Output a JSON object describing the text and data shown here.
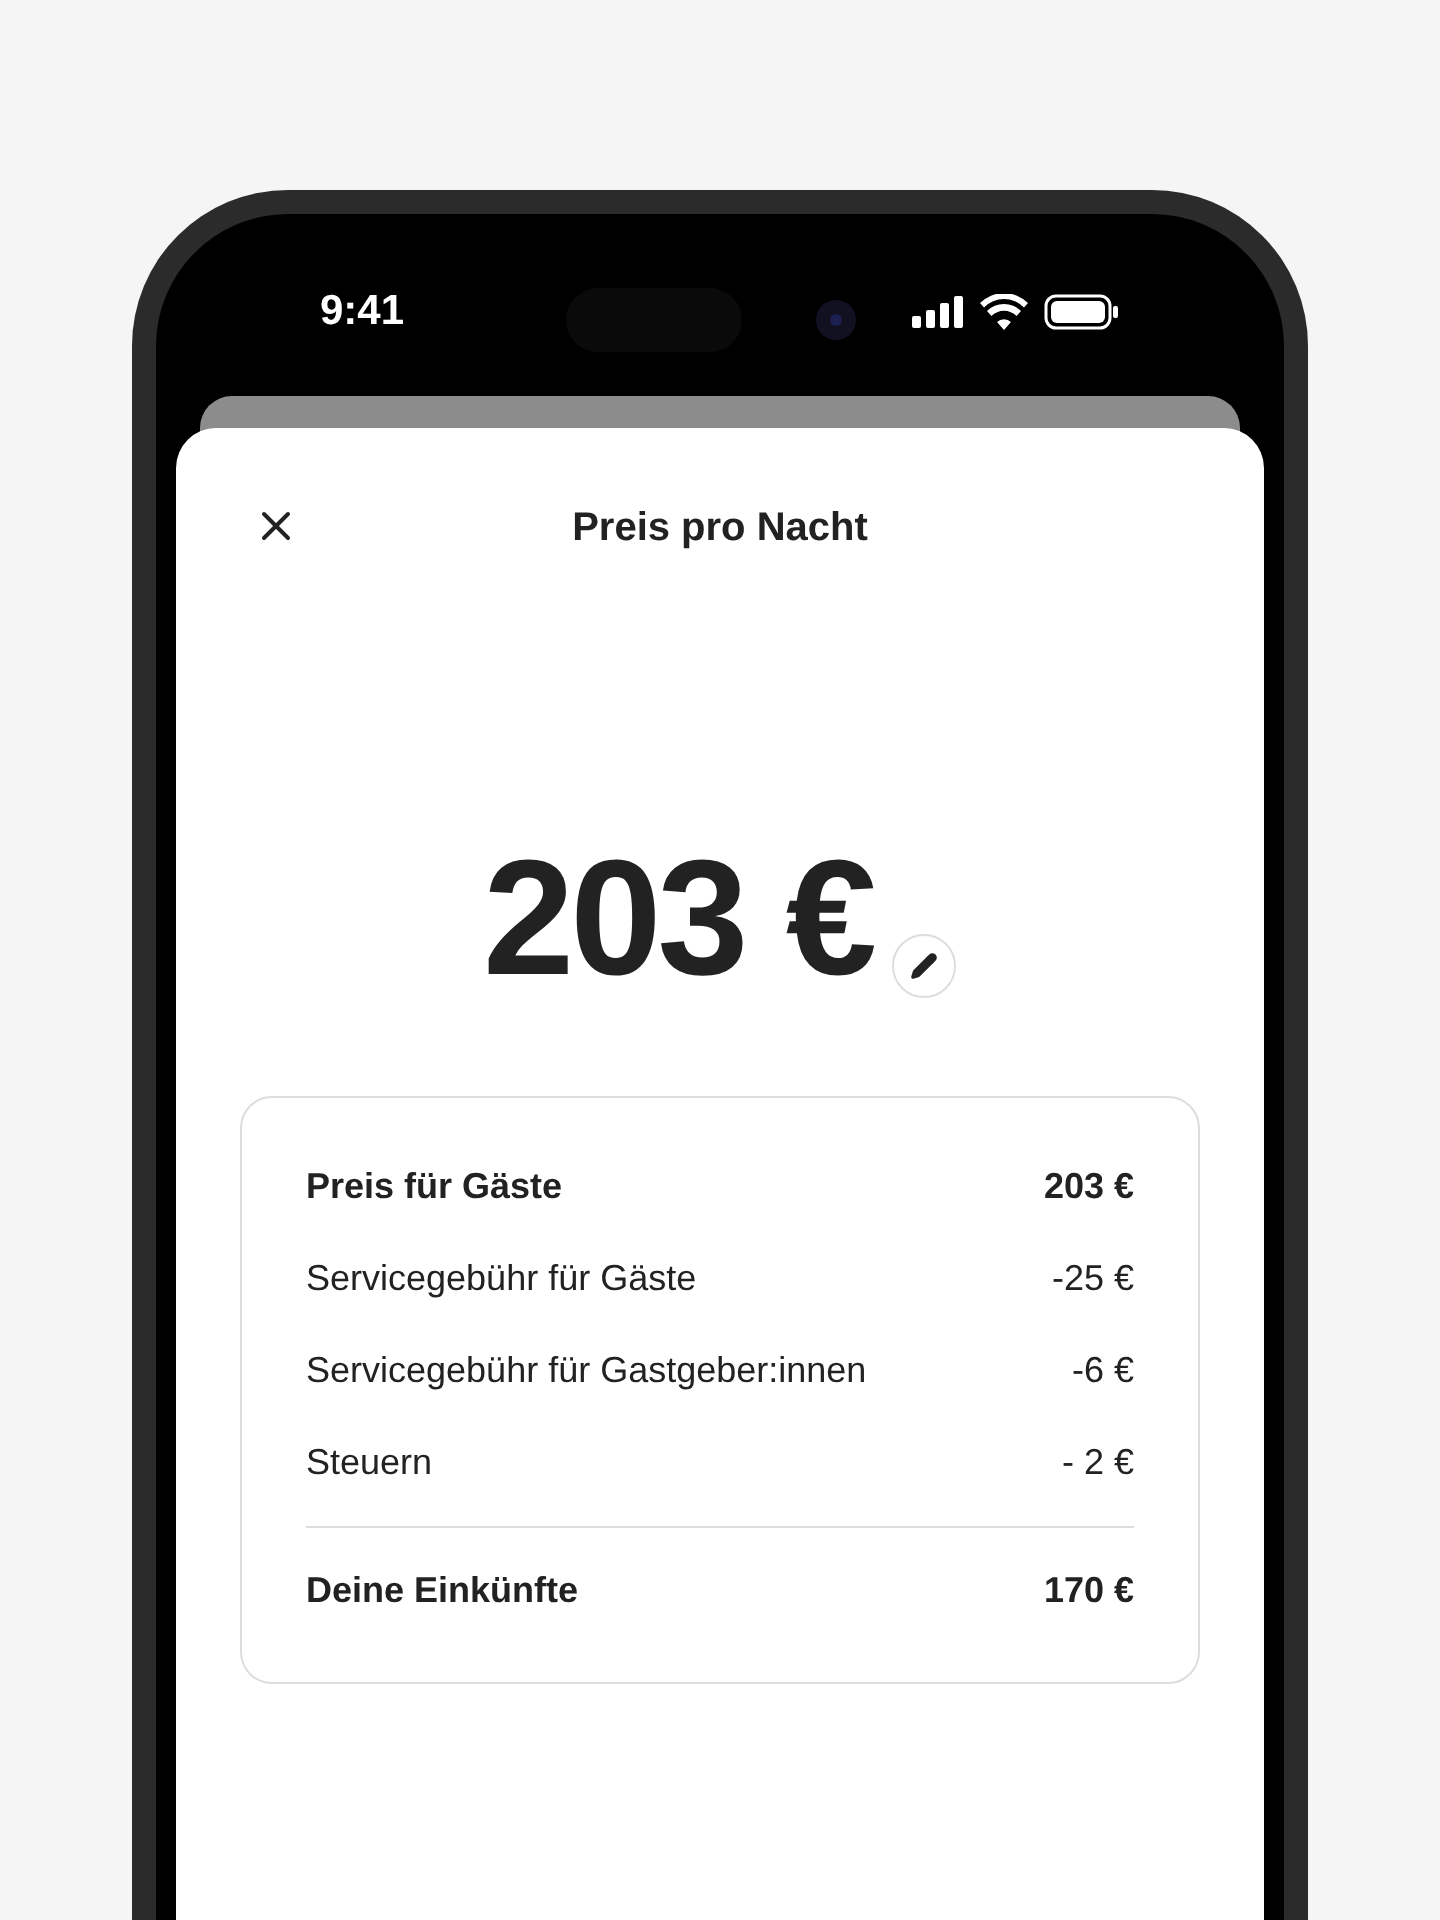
{
  "status_bar": {
    "time": "9:41"
  },
  "sheet": {
    "title": "Preis pro Nacht",
    "price": "203 €"
  },
  "breakdown": [
    {
      "kind": "subtotal",
      "label": "Preis für Gäste",
      "amount": "203 €"
    },
    {
      "kind": "deduction",
      "label": "Servicegebühr für Gäste",
      "amount": "-25 €"
    },
    {
      "kind": "deduction",
      "label": "Servicegebühr für Gastgeber:innen",
      "amount": "-6 €"
    },
    {
      "kind": "deduction",
      "label": "Steuern",
      "amount": "- 2 €"
    },
    {
      "kind": "total",
      "label": "Deine Einkünfte",
      "amount": "170 €"
    }
  ]
}
